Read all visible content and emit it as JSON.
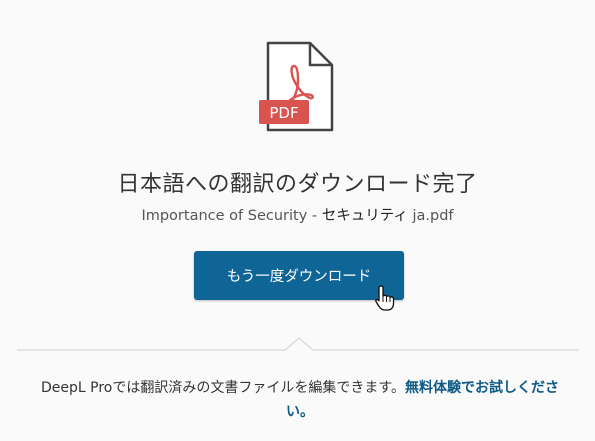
{
  "icon": {
    "badge_label": "PDF"
  },
  "status": {
    "title": "日本語への翻訳のダウンロード完了",
    "filename_prefix": "Importance of Security - ",
    "filename_ja": "セキュリティ",
    "filename_suffix": " ja.pdf"
  },
  "actions": {
    "download_again_label": "もう一度ダウンロード"
  },
  "promo": {
    "text": "DeepL Proでは翻訳済みの文書ファイルを編集できます。",
    "link_text": "無料体験でお試しください。"
  },
  "colors": {
    "accent": "#0f6596",
    "pdf_red": "#d9534f",
    "link": "#0f5a85"
  }
}
